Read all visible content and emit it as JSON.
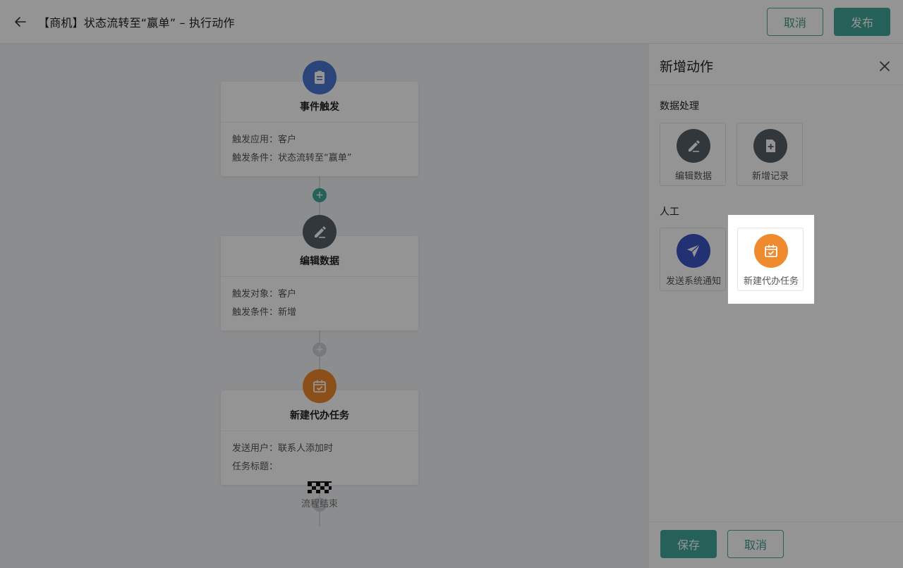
{
  "header": {
    "title": "【商机】状态流转至“赢单” – 执行动作",
    "cancel_label": "取消",
    "publish_label": "发布"
  },
  "flow": {
    "nodes": [
      {
        "title": "事件触发",
        "icon": "clipboard-icon",
        "icon_color": "#4a78d4",
        "rows": [
          "触发应用：客户",
          "触发条件：状态流转至“赢单”"
        ]
      },
      {
        "title": "编辑数据",
        "icon": "pencil-icon",
        "icon_color": "#566068",
        "rows": [
          "触发对象：客户",
          "触发条件：新增"
        ]
      },
      {
        "title": "新建代办任务",
        "icon": "calendar-check-icon",
        "icon_color": "#f08a2e",
        "rows": [
          "发送用户：联系人添加时",
          "任务标题："
        ]
      }
    ],
    "end_label": "流程结束",
    "plus_active_color": "#3fa89a",
    "plus_idle_color": "#cdd0d3"
  },
  "panel": {
    "title": "新增动作",
    "sections": [
      {
        "label": "数据处理",
        "items": [
          {
            "label": "编辑数据",
            "icon": "pencil-icon",
            "color": "#566068"
          },
          {
            "label": "新增记录",
            "icon": "file-plus-icon",
            "color": "#566068"
          }
        ]
      },
      {
        "label": "人工",
        "items": [
          {
            "label": "发送系统通知",
            "icon": "paper-plane-icon",
            "color": "#3a55c5"
          },
          {
            "label": "新建代办任务",
            "icon": "calendar-check-icon",
            "color": "#f08a2e"
          }
        ]
      }
    ],
    "save_label": "保存",
    "cancel_label": "取消"
  },
  "colors": {
    "accent": "#43a79a",
    "overlay": "rgba(0,0,0,0.42)"
  }
}
